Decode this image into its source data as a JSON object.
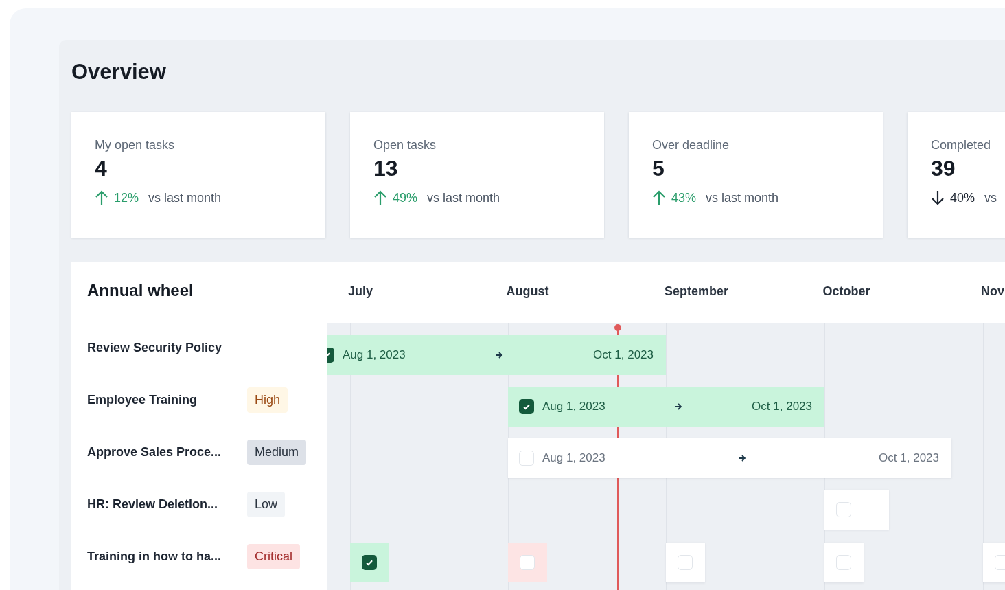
{
  "title": "Overview",
  "stats": [
    {
      "label": "My open tasks",
      "value": "4",
      "kind": "up",
      "change": "12%",
      "note": "vs last month"
    },
    {
      "label": "Open tasks",
      "value": "13",
      "kind": "up",
      "change": "49%",
      "note": "vs last month"
    },
    {
      "label": "Over deadline",
      "value": "5",
      "kind": "up",
      "change": "43%",
      "note": "vs last month"
    },
    {
      "label": "Completed",
      "value": "39",
      "kind": "down",
      "change": "40%",
      "note": "vs"
    }
  ],
  "annual_wheel": {
    "title": "Annual wheel",
    "months": [
      "July",
      "August",
      "September",
      "October",
      "Nov"
    ],
    "tasks": [
      {
        "name": "Review Security Policy",
        "bars": [
          {
            "kind": "range",
            "color": "#c9f4dc",
            "checked": true,
            "start": "Aug 1, 2023",
            "end": "Oct 1, 2023"
          }
        ]
      },
      {
        "name": "Employee Training",
        "priority": {
          "label": "High",
          "kind": "high"
        },
        "bars": [
          {
            "kind": "range",
            "color": "#c9f4dc",
            "checked": true,
            "start": "Aug 1, 2023",
            "end": "Oct 1, 2023"
          }
        ]
      },
      {
        "name": "Approve Sales Proce...",
        "priority": {
          "label": "Medium",
          "kind": "medium"
        },
        "bars": [
          {
            "kind": "range",
            "color": "#ffffff",
            "checked": false,
            "start": "Aug 1, 2023",
            "end": "Oct 1, 2023"
          }
        ]
      },
      {
        "name": "HR: Review Deletion...",
        "priority": {
          "label": "Low",
          "kind": "low"
        },
        "bars": [
          {
            "kind": "marker",
            "color": "#ffffff",
            "checked": false
          }
        ]
      },
      {
        "name": "Training in how to ha...",
        "priority": {
          "label": "Critical",
          "kind": "critical"
        },
        "bars": [
          {
            "kind": "marker",
            "color": "#c9f4dc",
            "checked": true
          },
          {
            "kind": "marker",
            "color": "#fde4e4",
            "checked": false
          },
          {
            "kind": "marker",
            "color": "#ffffff",
            "checked": false
          },
          {
            "kind": "marker",
            "color": "#ffffff",
            "checked": false
          },
          {
            "kind": "marker",
            "color": "#ffffff",
            "checked": false
          }
        ]
      }
    ]
  }
}
